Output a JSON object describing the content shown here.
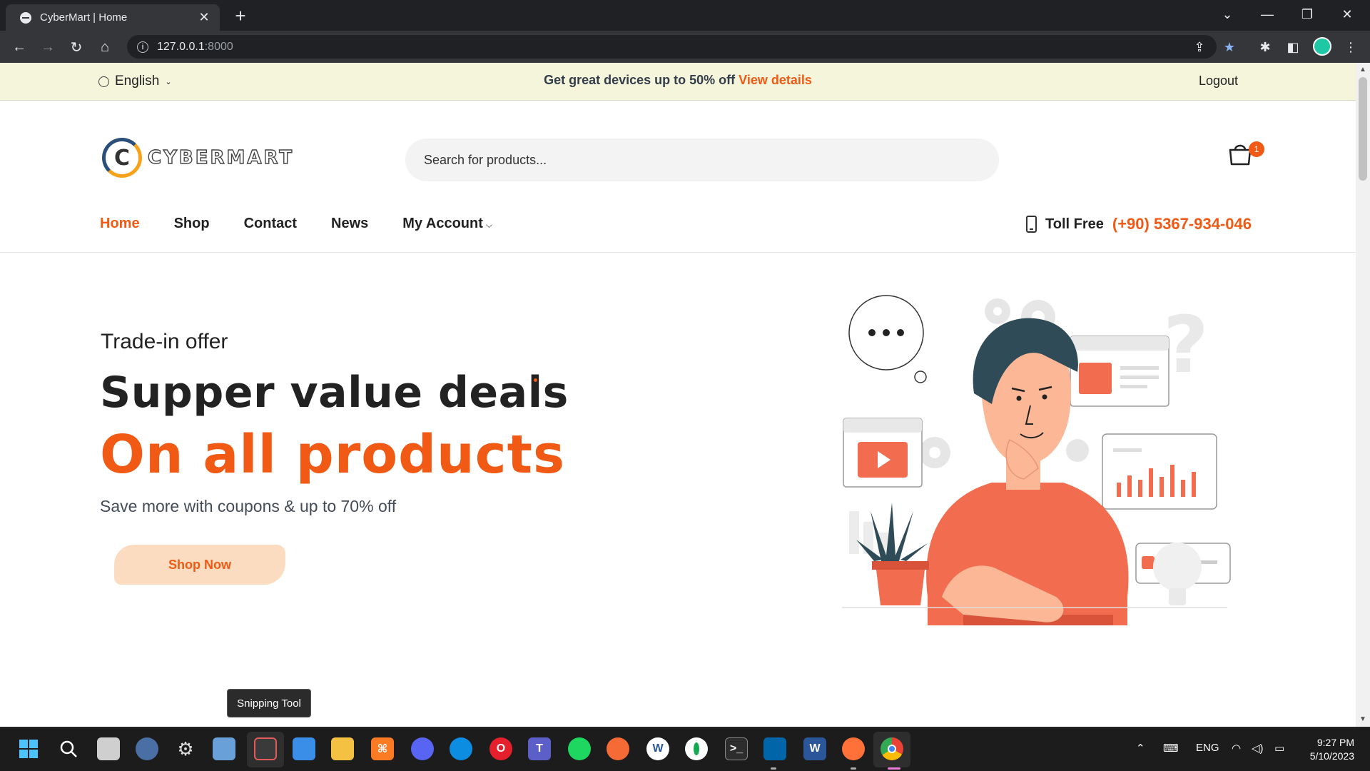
{
  "browser": {
    "tab_title": "CyberMart | Home",
    "tab_close": "✕",
    "new_tab": "+",
    "url_host": "127.0.0.1",
    "url_port": ":8000"
  },
  "topbar": {
    "language": "English",
    "promo_text": "Get great devices up to 50% off ",
    "promo_link": "View details",
    "logout": "Logout"
  },
  "header": {
    "logo_letter": "C",
    "logo_text": "CYBERMART",
    "search_placeholder": "Search for products...",
    "cart_count": "1"
  },
  "nav": {
    "items": [
      {
        "label": "Home",
        "active": true
      },
      {
        "label": "Shop"
      },
      {
        "label": "Contact"
      },
      {
        "label": "News"
      },
      {
        "label": "My Account"
      }
    ],
    "toll_free_label": "Toll Free",
    "toll_free_number": "(+90) 5367-934-046"
  },
  "hero": {
    "tagline": "Trade-in offer",
    "headline": "Supper value deals",
    "headline_accent": "On all products",
    "subtext": "Save more with coupons & up to 70% off",
    "cta": "Shop Now"
  },
  "tooltip": "Snipping Tool",
  "taskbar": {
    "language": "ENG",
    "time": "9:27 PM",
    "date": "5/10/2023"
  },
  "colors": {
    "accent": "#f05a14",
    "topbar_bg": "#f5f5dc",
    "cta_bg": "#fbdcc0",
    "text_dark": "#222222"
  }
}
